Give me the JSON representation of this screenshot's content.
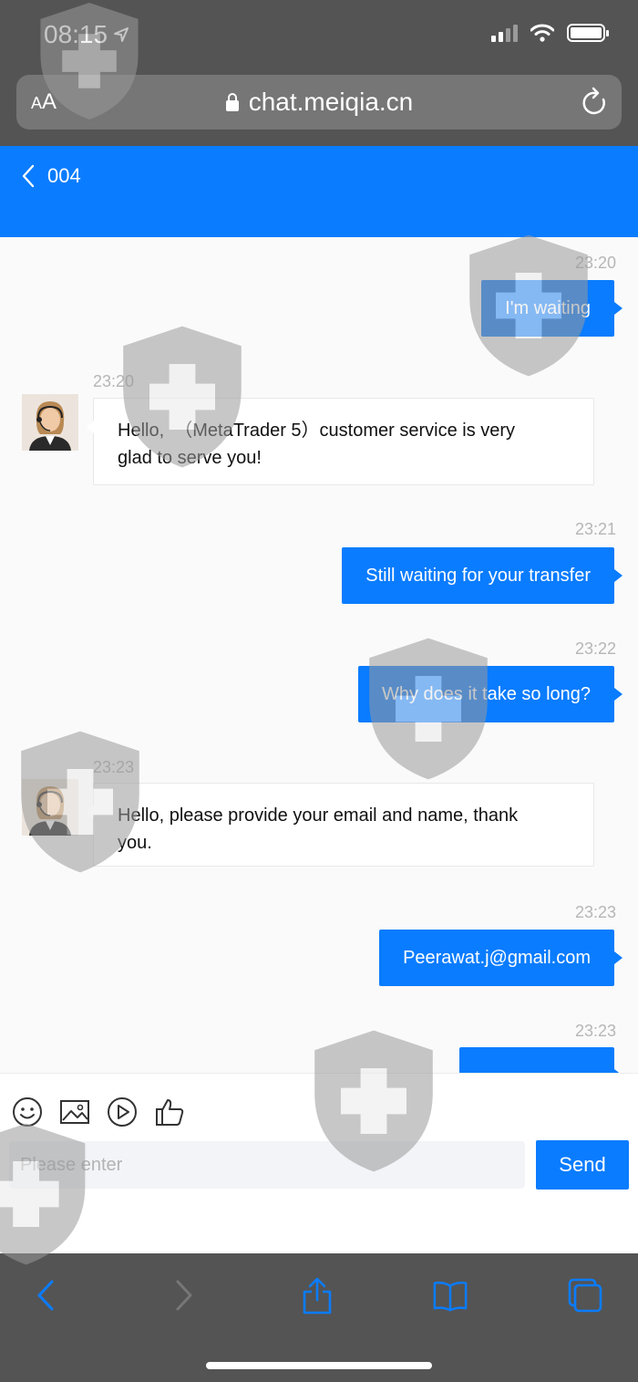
{
  "status_bar": {
    "time": "08:15"
  },
  "browser": {
    "text_size_label_small": "A",
    "text_size_label_large": "A",
    "url": "chat.meiqia.cn"
  },
  "header": {
    "title": "004"
  },
  "messages": [
    {
      "dir": "out",
      "time": "23:20",
      "text": "I'm waiting"
    },
    {
      "dir": "in",
      "time": "23:20",
      "lines": [
        "Hello,  （MetaTrader 5）customer service is very",
        "glad to serve you!"
      ]
    },
    {
      "dir": "out",
      "time": "23:21",
      "text": "Still waiting for your transfer"
    },
    {
      "dir": "out",
      "time": "23:22",
      "text": "Why does it take so long?"
    },
    {
      "dir": "in",
      "time": "23:23",
      "lines": [
        "Hello, please provide your email and name, thank",
        "you."
      ]
    },
    {
      "dir": "out",
      "time": "23:23",
      "text": "Peerawat.j@gmail.com"
    },
    {
      "dir": "out",
      "time": "23:23",
      "text": ""
    }
  ],
  "composer": {
    "tools": [
      "smiley-icon",
      "image-icon",
      "play-icon",
      "thumbs-up-icon"
    ],
    "placeholder": "Please enter",
    "send_label": "Send"
  },
  "colors": {
    "accent": "#0a7cff",
    "chrome": "#545454"
  }
}
